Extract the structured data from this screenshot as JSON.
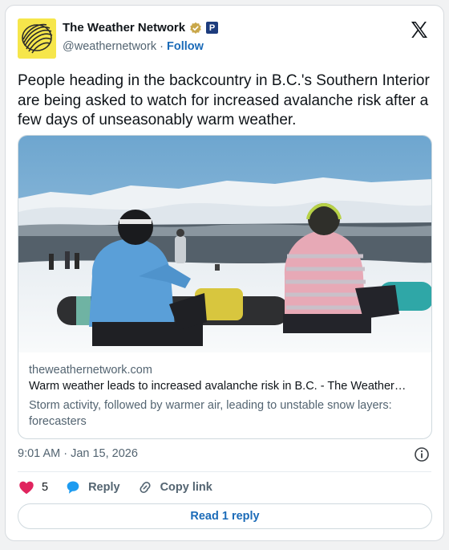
{
  "author": {
    "name": "The Weather Network",
    "handle": "@weathernetwork",
    "separator": "·",
    "follow_label": "Follow",
    "badge_letter": "P"
  },
  "tweet": {
    "text": "People heading in the backcountry in B.C.'s Southern Interior are being asked to watch for increased avalanche risk after a few days of unseasonably warm weather."
  },
  "link_card": {
    "domain": "theweathernetwork.com",
    "title": "Warm weather leads to increased avalanche risk in B.C. - The Weather…",
    "description": "Storm activity, followed by warmer air, leading to unstable snow layers: forecasters"
  },
  "timestamp": "9:01 AM · Jan 15, 2026",
  "actions": {
    "like_count": "5",
    "reply_label": "Reply",
    "copy_link_label": "Copy link"
  },
  "read_reply_label": "Read 1 reply",
  "colors": {
    "accent": "#1b6bb8",
    "like": "#e0245e",
    "reply": "#1d9bf0",
    "avatar_bg": "#f6e64b"
  },
  "icons": [
    "x-logo-icon",
    "verified-badge-icon",
    "info-icon",
    "heart-icon",
    "reply-bubble-icon",
    "link-icon"
  ]
}
